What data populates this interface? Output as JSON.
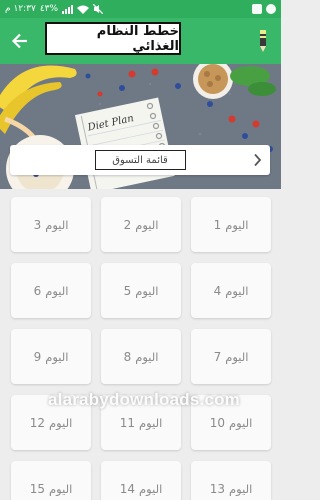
{
  "status_bar": {
    "time": "١٢:٣٧ م",
    "battery": "٤٣%"
  },
  "app_bar": {
    "title": "خطط النظام الغذائي",
    "back_icon": "arrow-left-icon",
    "edit_icon": "pencil-icon"
  },
  "banner": {
    "notebook_text": "Diet Plan"
  },
  "shopping": {
    "label": "قائمة التسوق",
    "icon": "chevron-right-icon"
  },
  "days": [
    {
      "word": "اليوم",
      "num": "1"
    },
    {
      "word": "اليوم",
      "num": "2"
    },
    {
      "word": "اليوم",
      "num": "3"
    },
    {
      "word": "اليوم",
      "num": "4"
    },
    {
      "word": "اليوم",
      "num": "5"
    },
    {
      "word": "اليوم",
      "num": "6"
    },
    {
      "word": "اليوم",
      "num": "7"
    },
    {
      "word": "اليوم",
      "num": "8"
    },
    {
      "word": "اليوم",
      "num": "9"
    },
    {
      "word": "اليوم",
      "num": "10"
    },
    {
      "word": "اليوم",
      "num": "11"
    },
    {
      "word": "اليوم",
      "num": "12"
    },
    {
      "word": "اليوم",
      "num": "13"
    },
    {
      "word": "اليوم",
      "num": "14"
    },
    {
      "word": "اليوم",
      "num": "15"
    }
  ],
  "watermark": "alarabydownloads.com",
  "colors": {
    "status_bar": "#2fae5e",
    "app_bar": "#39b86a",
    "background": "#ededed",
    "card": "#fafafa",
    "card_text": "#8b8b8b"
  }
}
